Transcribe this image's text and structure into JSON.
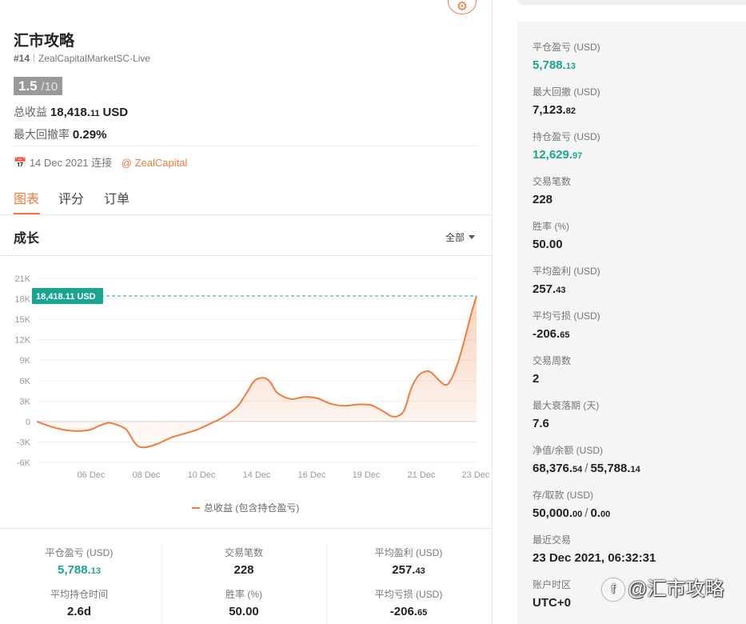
{
  "header": {
    "title": "汇市攻略",
    "rank": "#14",
    "account": "ZealCapitalMarketSC-Live",
    "score": "1.5",
    "score_max": "/10",
    "total_profit_label": "总收益",
    "total_profit_main": "18,418.",
    "total_profit_dec": "11",
    "total_profit_unit": "USD",
    "max_drawdown_label": "最大回撤率",
    "max_drawdown_value": "0.29%",
    "connect_date": "14 Dec 2021 连接",
    "connect_link": "@ ZealCapital"
  },
  "tabs": [
    {
      "label": "图表"
    },
    {
      "label": "评分"
    },
    {
      "label": "订单"
    }
  ],
  "section": {
    "title": "成长",
    "range_label": "全部"
  },
  "chart_data": {
    "type": "area",
    "series": [
      {
        "name": "总收益 (包含持仓盈亏)",
        "color": "#f07c3e"
      }
    ],
    "x_tick_labels": [
      "06 Dec",
      "08 Dec",
      "10 Dec",
      "14 Dec",
      "16 Dec",
      "19 Dec",
      "21 Dec",
      "23 Dec"
    ],
    "y_tick_labels": [
      "21K",
      "18K",
      "15K",
      "12K",
      "9K",
      "6K",
      "3K",
      "0",
      "-3K",
      "-6K"
    ],
    "ylim": [
      -6000,
      21000
    ],
    "x_index_range": [
      0,
      32
    ],
    "points": [
      {
        "x": 0,
        "y": 0
      },
      {
        "x": 1,
        "y": -700
      },
      {
        "x": 2,
        "y": -1200
      },
      {
        "x": 3,
        "y": -1400
      },
      {
        "x": 4,
        "y": -1200
      },
      {
        "x": 4.7,
        "y": -600
      },
      {
        "x": 5.4,
        "y": -200
      },
      {
        "x": 6,
        "y": -500
      },
      {
        "x": 6.7,
        "y": -1200
      },
      {
        "x": 7.4,
        "y": -3300
      },
      {
        "x": 8,
        "y": -3800
      },
      {
        "x": 9,
        "y": -3300
      },
      {
        "x": 10,
        "y": -2400
      },
      {
        "x": 11,
        "y": -1800
      },
      {
        "x": 12,
        "y": -1200
      },
      {
        "x": 13,
        "y": -300
      },
      {
        "x": 14,
        "y": 700
      },
      {
        "x": 15,
        "y": 2200
      },
      {
        "x": 15.7,
        "y": 4200
      },
      {
        "x": 16.3,
        "y": 6000
      },
      {
        "x": 17,
        "y": 6400
      },
      {
        "x": 17.5,
        "y": 5700
      },
      {
        "x": 18,
        "y": 4200
      },
      {
        "x": 19,
        "y": 3300
      },
      {
        "x": 20,
        "y": 3600
      },
      {
        "x": 21,
        "y": 3400
      },
      {
        "x": 22,
        "y": 2600
      },
      {
        "x": 23,
        "y": 2300
      },
      {
        "x": 24,
        "y": 2500
      },
      {
        "x": 25,
        "y": 2400
      },
      {
        "x": 26,
        "y": 1400
      },
      {
        "x": 26.5,
        "y": 800
      },
      {
        "x": 27,
        "y": 800
      },
      {
        "x": 27.5,
        "y": 1700
      },
      {
        "x": 28,
        "y": 4800
      },
      {
        "x": 28.5,
        "y": 6600
      },
      {
        "x": 29,
        "y": 7300
      },
      {
        "x": 29.5,
        "y": 7200
      },
      {
        "x": 30.5,
        "y": 5400
      },
      {
        "x": 31,
        "y": 6200
      },
      {
        "x": 31.5,
        "y": 8600
      },
      {
        "x": 32,
        "y": 12000
      },
      {
        "x": 32.5,
        "y": 15800
      },
      {
        "x": 32.9,
        "y": 18418
      }
    ],
    "last_value_label": "18,418.11 USD",
    "last_value": 18418.11,
    "grid": true,
    "legend_position": "bottom-center"
  },
  "bottom_stats": [
    {
      "label": "平仓盈亏 (USD)",
      "main": "5,788.",
      "dec": "13",
      "green": true
    },
    {
      "label": "交易笔数",
      "main": "228",
      "dec": "",
      "green": false
    },
    {
      "label": "平均盈利 (USD)",
      "main": "257.",
      "dec": "43",
      "green": false
    },
    {
      "label": "平均持仓时间",
      "main": "2.6d",
      "dec": "",
      "green": false
    },
    {
      "label": "胜率 (%)",
      "main": "50.00",
      "dec": "",
      "green": false
    },
    {
      "label": "平均亏损 (USD)",
      "main": "-206.",
      "dec": "65",
      "green": false
    }
  ],
  "right_stats": [
    {
      "label": "平仓盈亏 (USD)",
      "main": "5,788.",
      "dec": "13",
      "green": true
    },
    {
      "label": "最大回撤 (USD)",
      "main": "7,123.",
      "dec": "82",
      "green": false
    },
    {
      "label": "持仓盈亏 (USD)",
      "main": "12,629.",
      "dec": "97",
      "green": true
    },
    {
      "label": "交易笔数",
      "main": "228",
      "dec": "",
      "green": false
    },
    {
      "label": "胜率 (%)",
      "main": "50.00",
      "dec": "",
      "green": false
    },
    {
      "label": "平均盈利 (USD)",
      "main": "257.",
      "dec": "43",
      "green": false
    },
    {
      "label": "平均亏损 (USD)",
      "main": "-206.",
      "dec": "65",
      "green": false
    },
    {
      "label": "交易周数",
      "main": "2",
      "dec": "",
      "green": false
    },
    {
      "label": "最大衰落期 (天)",
      "main": "7.6",
      "dec": "",
      "green": false
    }
  ],
  "right_pairs": [
    {
      "label": "净值/余额 (USD)",
      "a_main": "68,376.",
      "a_dec": "54",
      "sep": "/",
      "b_main": "55,788.",
      "b_dec": "14"
    },
    {
      "label": "存/取款 (USD)",
      "a_main": "50,000.",
      "a_dec": "00",
      "sep": "/",
      "b_main": "0.",
      "b_dec": "00"
    }
  ],
  "right_tail": [
    {
      "label": "最近交易",
      "main": "23 Dec 2021, 06:32:31"
    },
    {
      "label": "账户时区",
      "main": "UTC+0"
    }
  ],
  "watermark": {
    "icon": "f",
    "text": "@汇市攻略"
  },
  "icons": {
    "settings": "gear-icon",
    "calendar": "calendar-icon",
    "dropdown": "caret-down-icon"
  },
  "colors": {
    "accent": "#f07c3e",
    "positive": "#1aa593",
    "tooltip_bg": "#1aa593"
  }
}
